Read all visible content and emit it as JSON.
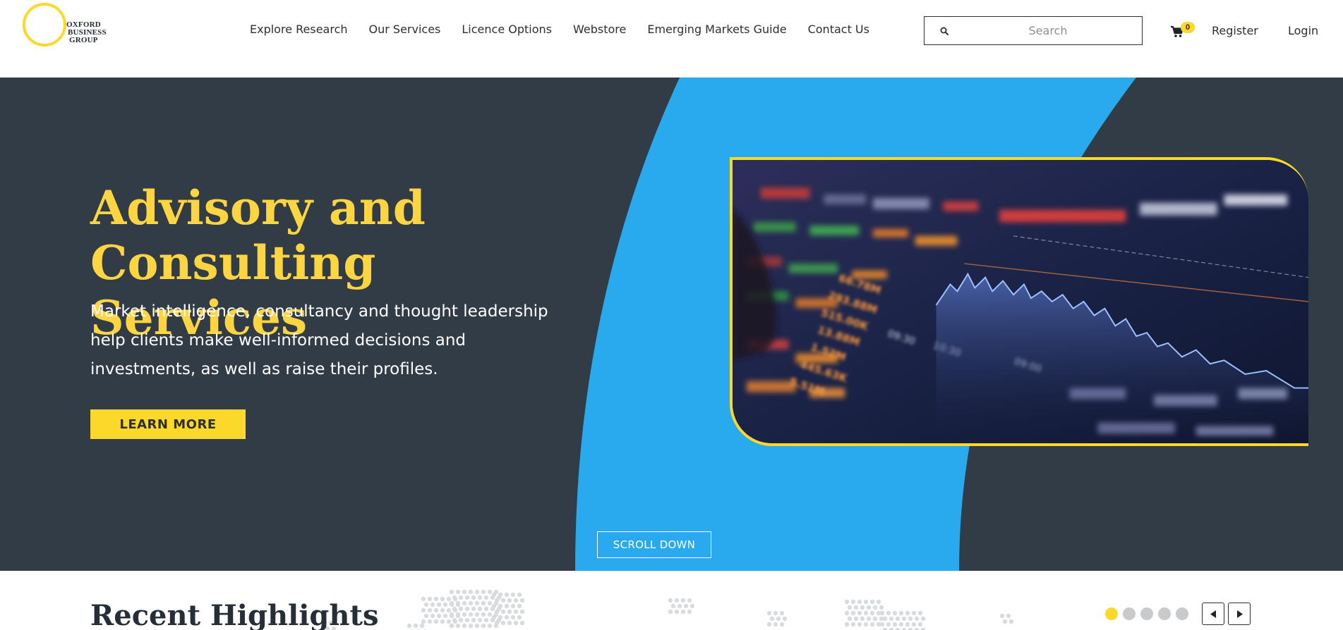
{
  "logo": {
    "line1": "OXFORD",
    "line2": "BUSINESS",
    "line3": "GROUP",
    "ring_color": "#fcd82a"
  },
  "nav": {
    "items": [
      "Explore Research",
      "Our Services",
      "Licence Options",
      "Webstore",
      "Emerging Markets Guide",
      "Contact Us"
    ]
  },
  "search": {
    "placeholder": "Search",
    "value": "",
    "icon": "search-icon"
  },
  "cart": {
    "icon": "shopping-cart-icon",
    "count": "0"
  },
  "auth": {
    "register": "Register",
    "login": "Login"
  },
  "hero": {
    "title_line1": "Advisory and",
    "title_line2": "Consulting Services",
    "description": "Market intelligence, consultancy and thought leadership help clients make well-informed decisions and investments, as well as raise their profiles.",
    "cta": "LEARN MORE",
    "scroll": "SCROLL DOWN",
    "image": "stock-market-screen-image"
  },
  "highlights": {
    "title": "Recent Highlights",
    "slides": 5,
    "active_slide": 1,
    "prev_icon": "triangle-left-icon",
    "next_icon": "triangle-right-icon"
  },
  "colors": {
    "accent_yellow": "#fcd82a",
    "hero_dark": "#323c46",
    "hero_blue": "#29aaef",
    "text_dark": "#2b2f33"
  }
}
